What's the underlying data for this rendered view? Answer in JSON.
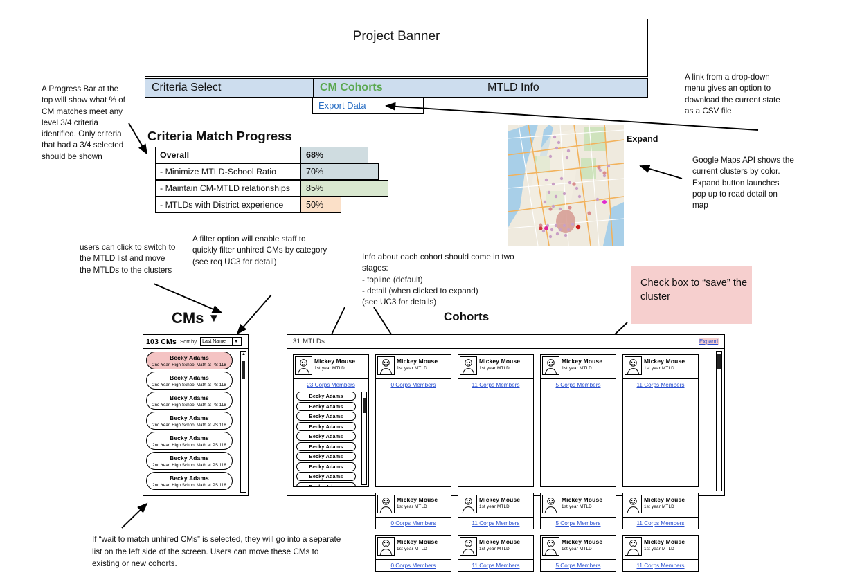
{
  "banner": {
    "title": "Project Banner"
  },
  "tabs": [
    {
      "label": "Criteria Select",
      "active": false
    },
    {
      "label": "CM Cohorts",
      "active": true
    },
    {
      "label": "MTLD Info",
      "active": false
    }
  ],
  "export": {
    "label": "Export Data"
  },
  "progress": {
    "title": "Criteria Match Progress",
    "rows": [
      {
        "label": "Overall",
        "value": "68%",
        "pct": 68,
        "color": "#cfdce0",
        "bold": true
      },
      {
        "label": "- Minimize MTLD-School Ratio",
        "value": "70%",
        "pct": 70,
        "color": "#cfdce0",
        "bold": false
      },
      {
        "label": "- Maintain CM-MTLD relationships",
        "value": "85%",
        "pct": 85,
        "color": "#d9e8d0",
        "bold": false
      },
      {
        "label": "- MTLDs with District experience",
        "value": "50%",
        "pct": 50,
        "color": "#fbe0c8",
        "bold": false
      }
    ]
  },
  "map": {
    "expand_label": "Expand"
  },
  "callouts": {
    "progress_bar": "A Progress Bar at the top will show what % of CM matches meet any level 3/4 criteria identified. Only criteria that had a 3/4 selected should be shown",
    "csv_link": "A link from a drop-down menu gives an option to download the current state as a CSV file",
    "google_maps": "Google Maps API shows the current clusters by color. Expand button launches pop up to read detail on map",
    "mtld_switch": "users can click to switch to the MTLD list and move the MTLDs to the clusters",
    "filter_option": "A filter option will enable staff to quickly filter unhired CMs by category\n(see req UC3 for detail)",
    "cohort_info": "Info about each cohort should come in two stages:\n- topline (default)\n- detail (when clicked to expand)\n(see UC3 for details)",
    "check_box": "Check box to\n“save” the cluster",
    "unhired_cms": "If “wait to match unhired CMs” is selected, they will go into a separate list on the left side of the screen. Users can move these CMs to existing or new cohorts."
  },
  "cms_panel": {
    "heading": "CMs",
    "count": "103 CMs",
    "sort_label": "Sort by",
    "sort_value": "Last Name",
    "cards": [
      {
        "name": "Becky Adams",
        "detail": "2nd Year, High School Math at PS 118",
        "selected": true
      },
      {
        "name": "Becky Adams",
        "detail": "2nd Year, High School Math at PS 118",
        "selected": false
      },
      {
        "name": "Becky Adams",
        "detail": "2nd Year, High School Math at PS 118",
        "selected": false
      },
      {
        "name": "Becky Adams",
        "detail": "2nd Year, High School Math at PS 118",
        "selected": false
      },
      {
        "name": "Becky Adams",
        "detail": "2nd Year, High School Math at PS 118",
        "selected": false
      },
      {
        "name": "Becky Adams",
        "detail": "2nd Year, High School Math at PS 118",
        "selected": false
      },
      {
        "name": "Becky Adams",
        "detail": "2nd Year, High School Math at PS 118",
        "selected": false
      }
    ]
  },
  "cohorts_panel": {
    "heading": "Cohorts",
    "count": "31 MTLDs",
    "expand_label": "Expand",
    "expanded_card": {
      "name": "Mickey Mouse",
      "role": "1st year MTLD",
      "members_link": "23 Corps Members",
      "members": [
        "Becky Adams",
        "Becky Adams",
        "Becky Adams",
        "Becky Adams",
        "Becky Adams",
        "Becky Adams",
        "Becky Adams",
        "Becky Adams",
        "Becky Adams",
        "Becky Adams"
      ]
    },
    "rows": [
      [
        {
          "name": "Mickey Mouse",
          "role": "1st year MTLD",
          "members_link": "0 Corps Members"
        },
        {
          "name": "Mickey Mouse",
          "role": "1st year MTLD",
          "members_link": "11 Corps Members"
        },
        {
          "name": "Mickey Mouse",
          "role": "1st year MTLD",
          "members_link": "5 Corps Members"
        },
        {
          "name": "Mickey Mouse",
          "role": "1st year MTLD",
          "members_link": "11 Corps Members"
        }
      ],
      [
        {
          "name": "Mickey Mouse",
          "role": "1st year MTLD",
          "members_link": "0 Corps Members"
        },
        {
          "name": "Mickey Mouse",
          "role": "1st year MTLD",
          "members_link": "11 Corps Members"
        },
        {
          "name": "Mickey Mouse",
          "role": "1st year MTLD",
          "members_link": "5 Corps Members"
        },
        {
          "name": "Mickey Mouse",
          "role": "1st year MTLD",
          "members_link": "11 Corps Members"
        }
      ],
      [
        {
          "name": "Mickey Mouse",
          "role": "1st year MTLD",
          "members_link": "0 Corps Members"
        },
        {
          "name": "Mickey Mouse",
          "role": "1st year MTLD",
          "members_link": "11 Corps Members"
        },
        {
          "name": "Mickey Mouse",
          "role": "1st year MTLD",
          "members_link": "5 Corps Members"
        },
        {
          "name": "Mickey Mouse",
          "role": "1st year MTLD",
          "members_link": "11 Corps Members"
        }
      ]
    ]
  },
  "colors": {
    "tab_bg": "#cdddee",
    "active_tab_text": "#5aa84f",
    "link": "#2a4fd0",
    "callout_pink": "#f6cfce",
    "selected_card": "#f4c3c3"
  }
}
